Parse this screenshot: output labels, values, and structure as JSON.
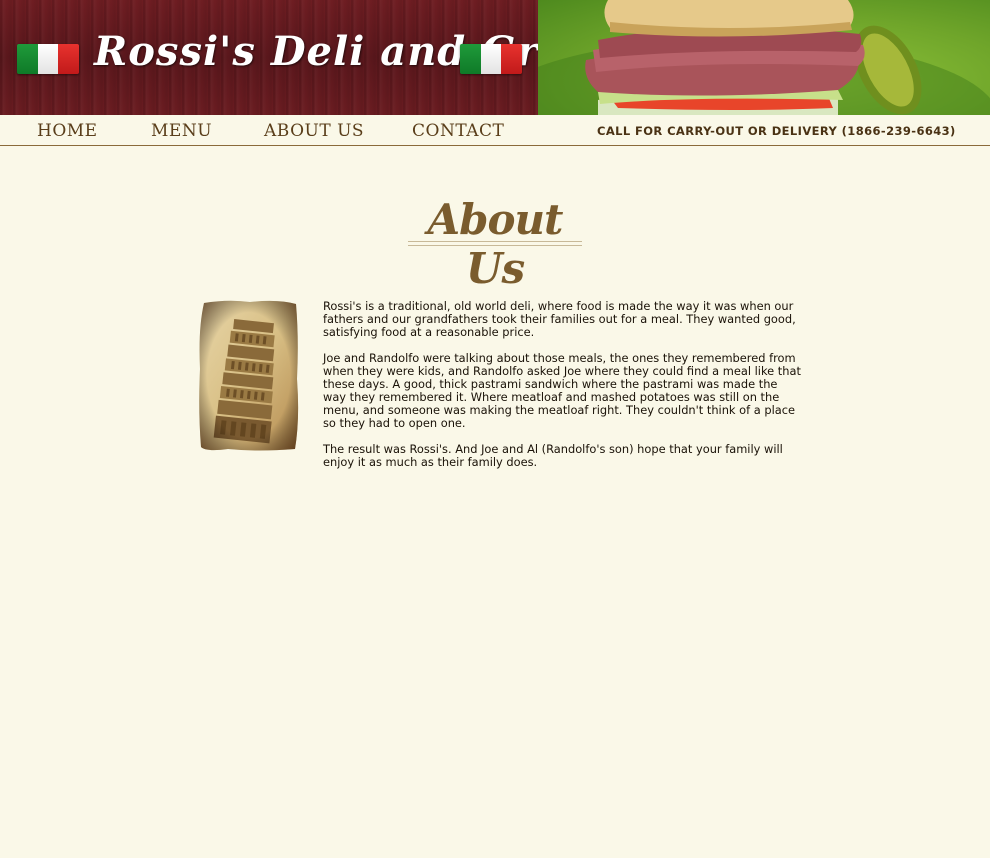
{
  "header": {
    "logo_text": "Rossi's Deli and Grill"
  },
  "nav": {
    "items": [
      {
        "label": "HOME"
      },
      {
        "label": "MENU"
      },
      {
        "label": "ABOUT US"
      },
      {
        "label": "CONTACT"
      }
    ],
    "callout": "CALL FOR CARRY-OUT OR DELIVERY (1866-239-6643)"
  },
  "page": {
    "title": "About Us",
    "paragraphs": [
      "Rossi's is a traditional, old world deli, where food is made the way it was when our fathers and our grandfathers took their families out for a meal. They wanted good, satisfying food at a reasonable price.",
      "Joe and Randolfo were talking about those meals, the ones they remembered from when they were kids, and Randolfo asked Joe where they could find a meal like that these days. A good, thick pastrami sandwich where the pastrami was made the way they remembered it. Where meatloaf and mashed potatoes was still on the menu, and someone was making the meatloaf right. They couldn't think of a place so they had to open one.",
      "The result was Rossi's. And Joe and Al (Randolfo's son) hope that your family will enjoy it as much as their family does."
    ]
  },
  "colors": {
    "background": "#faf8e8",
    "wood": "#5a171c",
    "nav_text": "#5a3e1a",
    "title": "#7a5c2e"
  }
}
